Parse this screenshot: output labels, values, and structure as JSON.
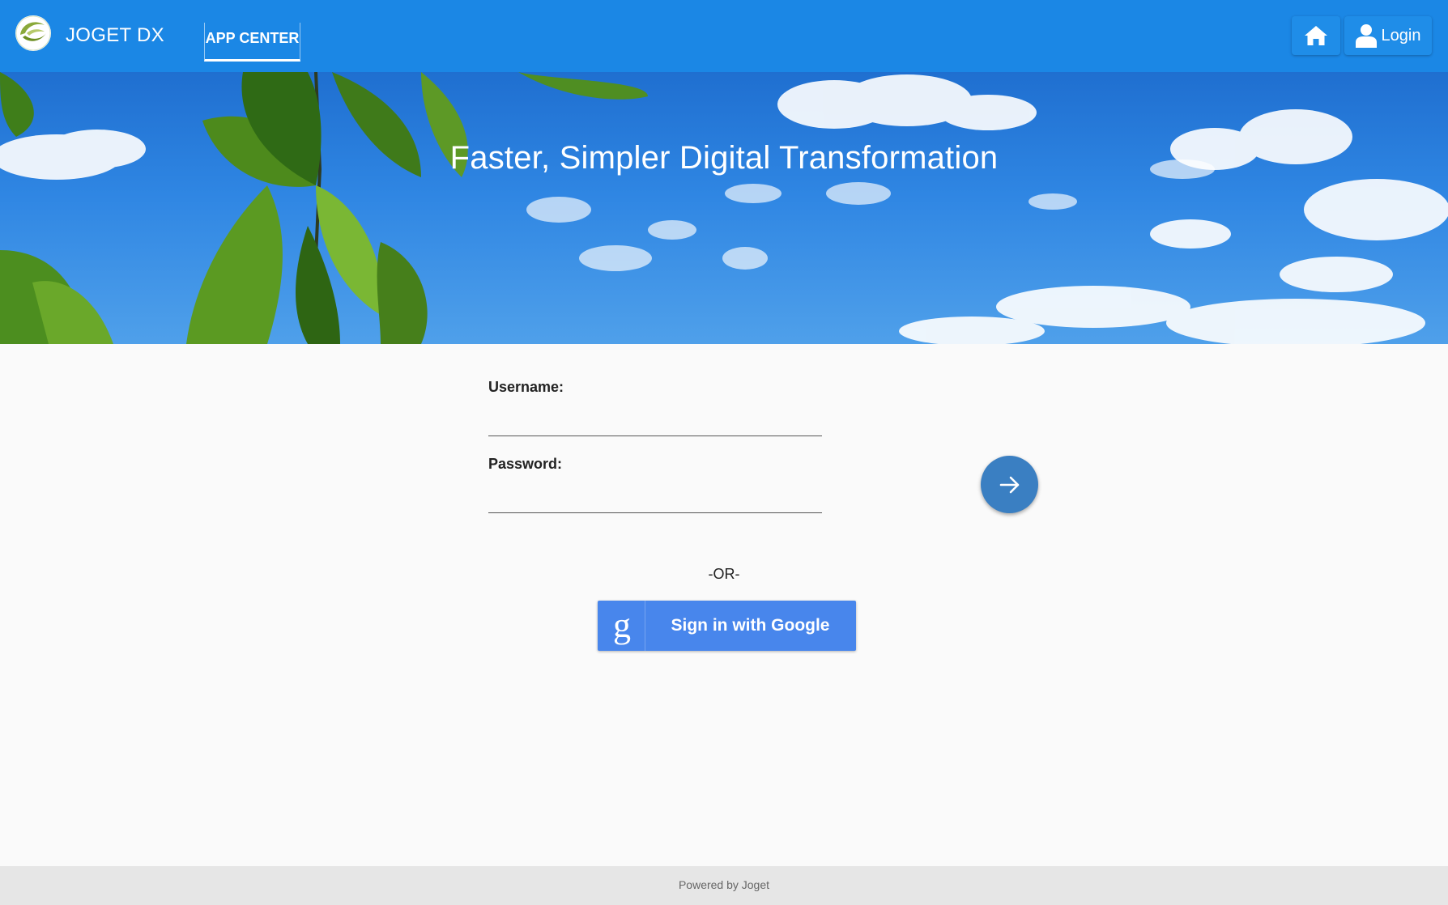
{
  "header": {
    "brand": "JOGET DX",
    "nav_tabs": [
      {
        "label": "APP CENTER",
        "active": true
      }
    ],
    "home_icon": "home-icon",
    "login_label": "Login",
    "login_icon": "user-icon",
    "color": "#1b87e5"
  },
  "banner": {
    "title": "Faster, Simpler Digital Transformation"
  },
  "login_form": {
    "username_label": "Username:",
    "username_value": "",
    "password_label": "Password:",
    "password_value": "",
    "submit_icon": "arrow-right-icon",
    "submit_color": "#3a7fc2"
  },
  "alt_login": {
    "or_text": "-OR-",
    "google_label": "Sign in with Google",
    "google_mark": "g",
    "google_color": "#4886ec"
  },
  "footer": {
    "text": "Powered by Joget"
  }
}
